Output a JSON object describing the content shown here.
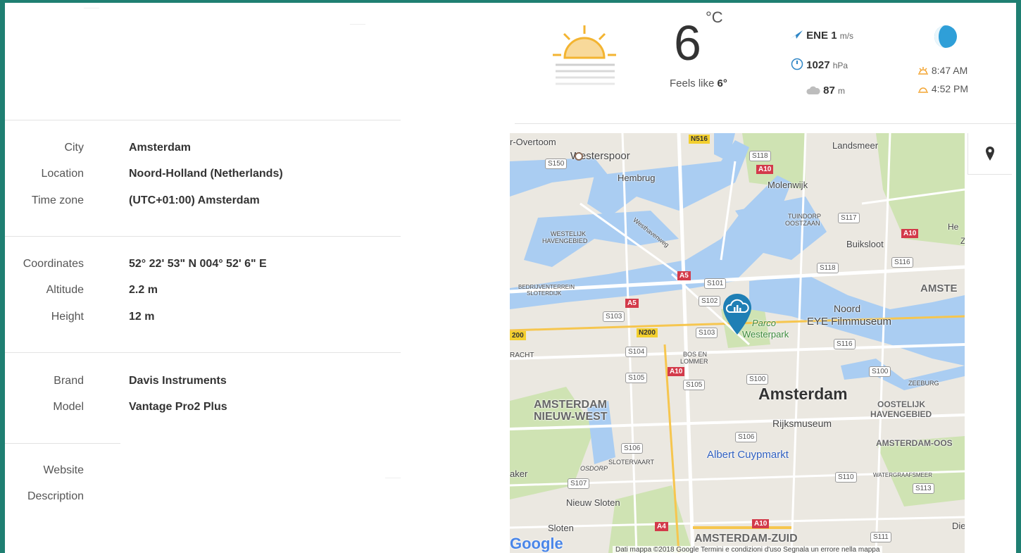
{
  "info": {
    "city_label": "City",
    "city_value": "Amsterdam",
    "location_label": "Location",
    "location_value": "Noord-Holland (Netherlands)",
    "timezone_label": "Time zone",
    "timezone_value": "(UTC+01:00) Amsterdam",
    "coordinates_label": "Coordinates",
    "coordinates_value": "52° 22' 53\" N  004° 52' 6\" E",
    "altitude_label": "Altitude",
    "altitude_value": "2.2 m",
    "height_label": "Height",
    "height_value": "12 m",
    "brand_label": "Brand",
    "brand_value": "Davis Instruments",
    "model_label": "Model",
    "model_value": "Vantage Pro2 Plus",
    "website_label": "Website",
    "description_label": "Description"
  },
  "weather": {
    "temperature": "6",
    "unit": "°C",
    "feels_like_prefix": "Feels like",
    "feels_like_value": "6°",
    "wind_dir": "ENE",
    "wind_speed": "1",
    "wind_unit": "m/s",
    "pressure": "1027",
    "pressure_unit": "hPa",
    "cloud": "87",
    "cloud_unit": "m",
    "sunrise": "8:47 AM",
    "sunset": "4:52 PM"
  },
  "map": {
    "labels": {
      "overtoom": "r-Overtoom",
      "westerspoor": "Westerspoor",
      "hembrug": "Hembrug",
      "landsmeer": "Landsmeer",
      "molenwijk": "Molenwijk",
      "tuindorp": "TUINDORP",
      "oostzaan": "OOSTZAAN",
      "westelijk": "WESTELIJK",
      "havengebied": "HAVENGEBIED",
      "westhavenweg": "Westhavenweg",
      "buiksloot": "Buiksloot",
      "amste": "AMSTE",
      "bedrijven": "BEDRIJVENTERREIN",
      "sloterdijk": "SLOTERDIJK",
      "noord": "Noord",
      "eye": "EYE Filmmuseum",
      "parco": "Parco",
      "westerpark": "Westerpark",
      "racht": "RACHT",
      "bos_en": "BOS EN",
      "lommer": "LOMMER",
      "amsterdam": "Amsterdam",
      "zeeburg": "ZEEBURG",
      "oostelijk": "OOSTELIJK",
      "havengebied2": "HAVENGEBIED",
      "amsterdam_nw1": "AMSTERDAM",
      "amsterdam_nw2": "NIEUW-WEST",
      "rijksmuseum": "Rijksmuseum",
      "amsterdam_oos": "AMSTERDAM-OOS",
      "albert": "Albert Cuypmarkt",
      "slotervaart": "SLOTERVAART",
      "osdorp": "OSDORP",
      "watergraafsmeer": "WATERGRAAFSMEER",
      "aker": "aker",
      "nieuw_sloten": "Nieuw Sloten",
      "sloten": "Sloten",
      "amsterdam_zuid": "AMSTERDAM-ZUID",
      "die": "Die",
      "he": "He",
      "z": "Z",
      "google": "Google",
      "attribution": "Dati mappa ©2018 Google   Termini e condizioni d'uso   Segnala un errore nella mappa"
    },
    "roads": {
      "n516": "N516",
      "s118a": "S118",
      "a10a": "A10",
      "s150": "S150",
      "s117": "S117",
      "a10b": "A10",
      "s118b": "S118",
      "s116a": "S116",
      "a5a": "A5",
      "s101": "S101",
      "s102": "S102",
      "a5b": "A5",
      "s103a": "S103",
      "n200": "N200",
      "s103b": "S103",
      "s116b": "S116",
      "s104": "S104",
      "a10c": "A10",
      "s105a": "S105",
      "s105b": "S105",
      "s100a": "S100",
      "s100b": "S100",
      "s106a": "S106",
      "s106b": "S106",
      "s107": "S107",
      "s110": "S110",
      "s113": "S113",
      "a4": "A4",
      "a10d": "A10",
      "s111": "S111",
      "n200b": "200"
    }
  }
}
